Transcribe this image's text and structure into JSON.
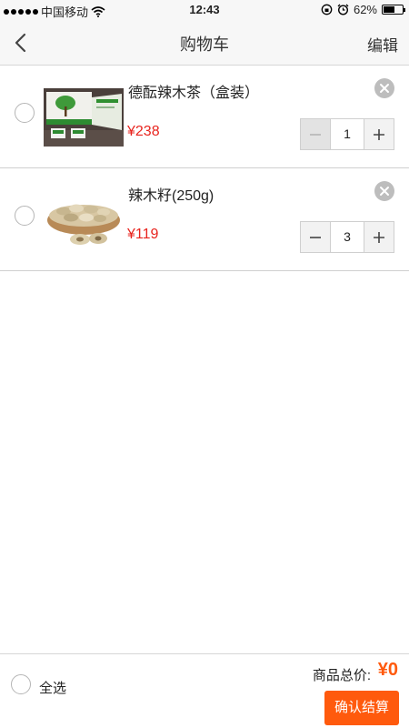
{
  "status_bar": {
    "carrier": "中国移动",
    "time": "12:43",
    "battery_percent": "62%",
    "battery_level": 0.62
  },
  "nav": {
    "title": "购物车",
    "edit_label": "编辑",
    "back_icon": "chevron-left-icon"
  },
  "items": [
    {
      "name": "德酝辣木茶（盒装）",
      "price": "¥238",
      "quantity": "1",
      "selected": false,
      "minus_disabled": true
    },
    {
      "name": "辣木籽(250g)",
      "price": "¥119",
      "quantity": "3",
      "selected": false,
      "minus_disabled": false
    }
  ],
  "footer": {
    "select_all_label": "全选",
    "total_label": "商品总价:",
    "total_value": "¥0",
    "checkout_label": "确认结算"
  },
  "colors": {
    "price_red": "#e8231d",
    "accent_orange": "#ff5a0d",
    "nav_background": "#f7f7f7"
  }
}
